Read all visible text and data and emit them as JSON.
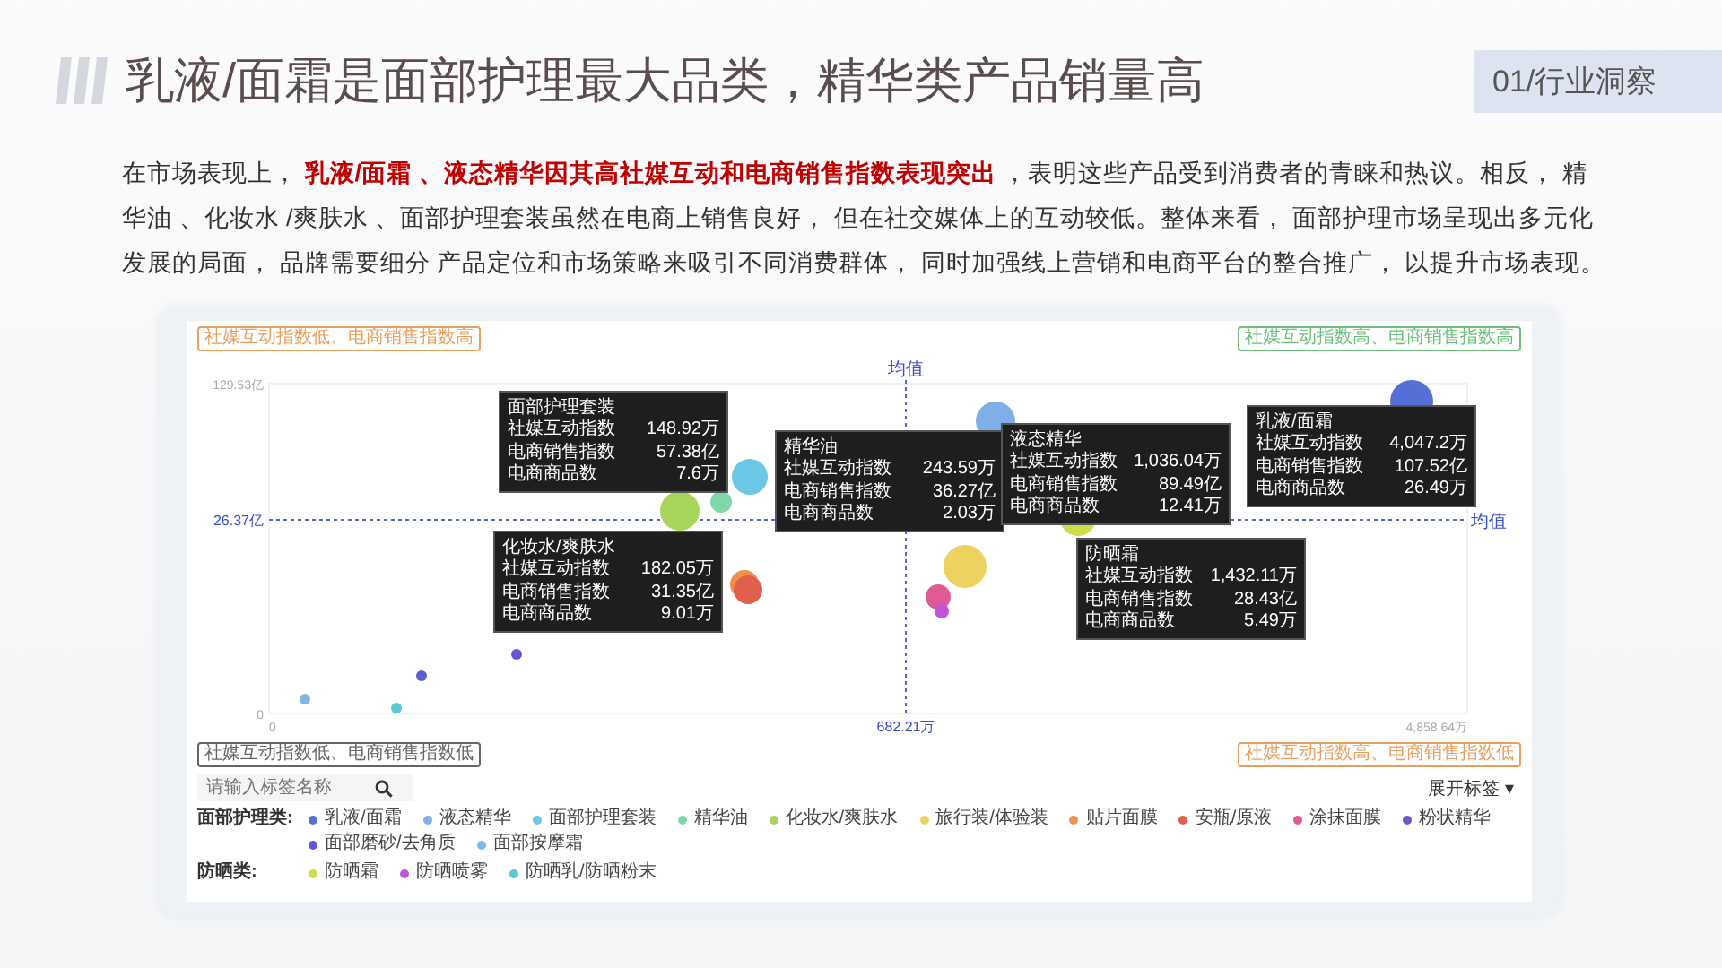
{
  "header": {
    "title": "乳液/面霜是面部护理最大品类，精华类产品销量高",
    "section_tag": "01/行业洞察"
  },
  "paragraph": "在市场表现上， **乳液/面霜 、液态精华因其高社媒互动和电商销售指数表现突出** ，表明这些产品受到消费者的青睐和热议。相反， 精华油 、化妆水 /爽肤水 、面部护理套装虽然在电商上销售良好， 但在社交媒体上的互动较低。整体来看， 面部护理市场呈现出多元化发展的局面， 品牌需要细分 产品定位和市场策略来吸引不同消费群体， 同时加强线上营销和电商平台的整合推广， 以提升市场表现。",
  "chart_panel": {
    "quadrant_tags": [
      {
        "text": "社媒互动指数低、电商销售指数高",
        "color": "#e8a060"
      },
      {
        "text": "社媒互动指数高、电商销售指数高",
        "color": "#6cbf7a"
      },
      {
        "text": "社媒互动指数低、电商销售指数低",
        "color": "#666666"
      },
      {
        "text": "社媒互动指数高、电商销售指数低",
        "color": "#e8a060"
      }
    ],
    "y_axis_labels": [
      "129.53亿",
      "26.37亿",
      "0"
    ],
    "x_axis_labels": [
      "0",
      "682.21万",
      "4,858.64万"
    ],
    "mean_labels": [
      "均值",
      "均值"
    ],
    "tooltips": [
      {
        "title": "面部护理套装",
        "rows": [
          {
            "label": "社媒互动指数",
            "value": "148.92万"
          },
          {
            "label": "电商销售指数",
            "value": "57.38亿"
          },
          {
            "label": "电商商品数",
            "value": "7.6万"
          }
        ]
      },
      {
        "title": "精华油",
        "rows": [
          {
            "label": "社媒互动指数",
            "value": "243.59万"
          },
          {
            "label": "电商销售指数",
            "value": "36.27亿"
          },
          {
            "label": "电商商品数",
            "value": "2.03万"
          }
        ]
      },
      {
        "title": "化妆水/爽肤水",
        "rows": [
          {
            "label": "社媒互动指数",
            "value": "182.05万"
          },
          {
            "label": "电商销售指数",
            "value": "31.35亿"
          },
          {
            "label": "电商商品数",
            "value": "9.01万"
          }
        ]
      },
      {
        "title": "液态精华",
        "rows": [
          {
            "label": "社媒互动指数",
            "value": "1,036.04万"
          },
          {
            "label": "电商销售指数",
            "value": "89.49亿"
          },
          {
            "label": "电商商品数",
            "value": "12.41万"
          }
        ]
      },
      {
        "title": "乳液/面霜",
        "rows": [
          {
            "label": "社媒互动指数",
            "value": "4,047.2万"
          },
          {
            "label": "电商销售指数",
            "value": "107.52亿"
          },
          {
            "label": "电商商品数",
            "value": "26.49万"
          }
        ]
      },
      {
        "title": "防晒霜",
        "rows": [
          {
            "label": "社媒互动指数",
            "value": "1,432.11万"
          },
          {
            "label": "电商销售指数",
            "value": "28.43亿"
          },
          {
            "label": "电商商品数",
            "value": "5.49万"
          }
        ]
      }
    ],
    "search": {
      "placeholder": "请输入标签名称"
    },
    "expand_button": "展开标签 ▾",
    "legend_groups": [
      {
        "label": "面部护理类:",
        "items": [
          {
            "name": "乳液/面霜",
            "color": "#5470d6"
          },
          {
            "name": "液态精华",
            "color": "#7faee8"
          },
          {
            "name": "面部护理套装",
            "color": "#6cc6e6"
          },
          {
            "name": "精华油",
            "color": "#7fd6a8"
          },
          {
            "name": "化妆水/爽肤水",
            "color": "#a9d65a"
          },
          {
            "name": "旅行装/体验装",
            "color": "#eed260"
          },
          {
            "name": "贴片面膜",
            "color": "#f0904a"
          },
          {
            "name": "安瓶/原液",
            "color": "#e0604e"
          },
          {
            "name": "涂抹面膜",
            "color": "#e05a96"
          },
          {
            "name": "粉状精华",
            "color": "#6a54d0"
          },
          {
            "name": "面部磨砂/去角质",
            "color": "#5b5bd6"
          },
          {
            "name": "面部按摩霜",
            "color": "#7fb8e0"
          }
        ]
      },
      {
        "label": "防晒类:",
        "items": [
          {
            "name": "防晒霜",
            "color": "#cfdc4a"
          },
          {
            "name": "防晒喷雾",
            "color": "#c056d6"
          },
          {
            "name": "防晒乳/防晒粉末",
            "color": "#5bc8d6"
          }
        ]
      }
    ]
  }
}
